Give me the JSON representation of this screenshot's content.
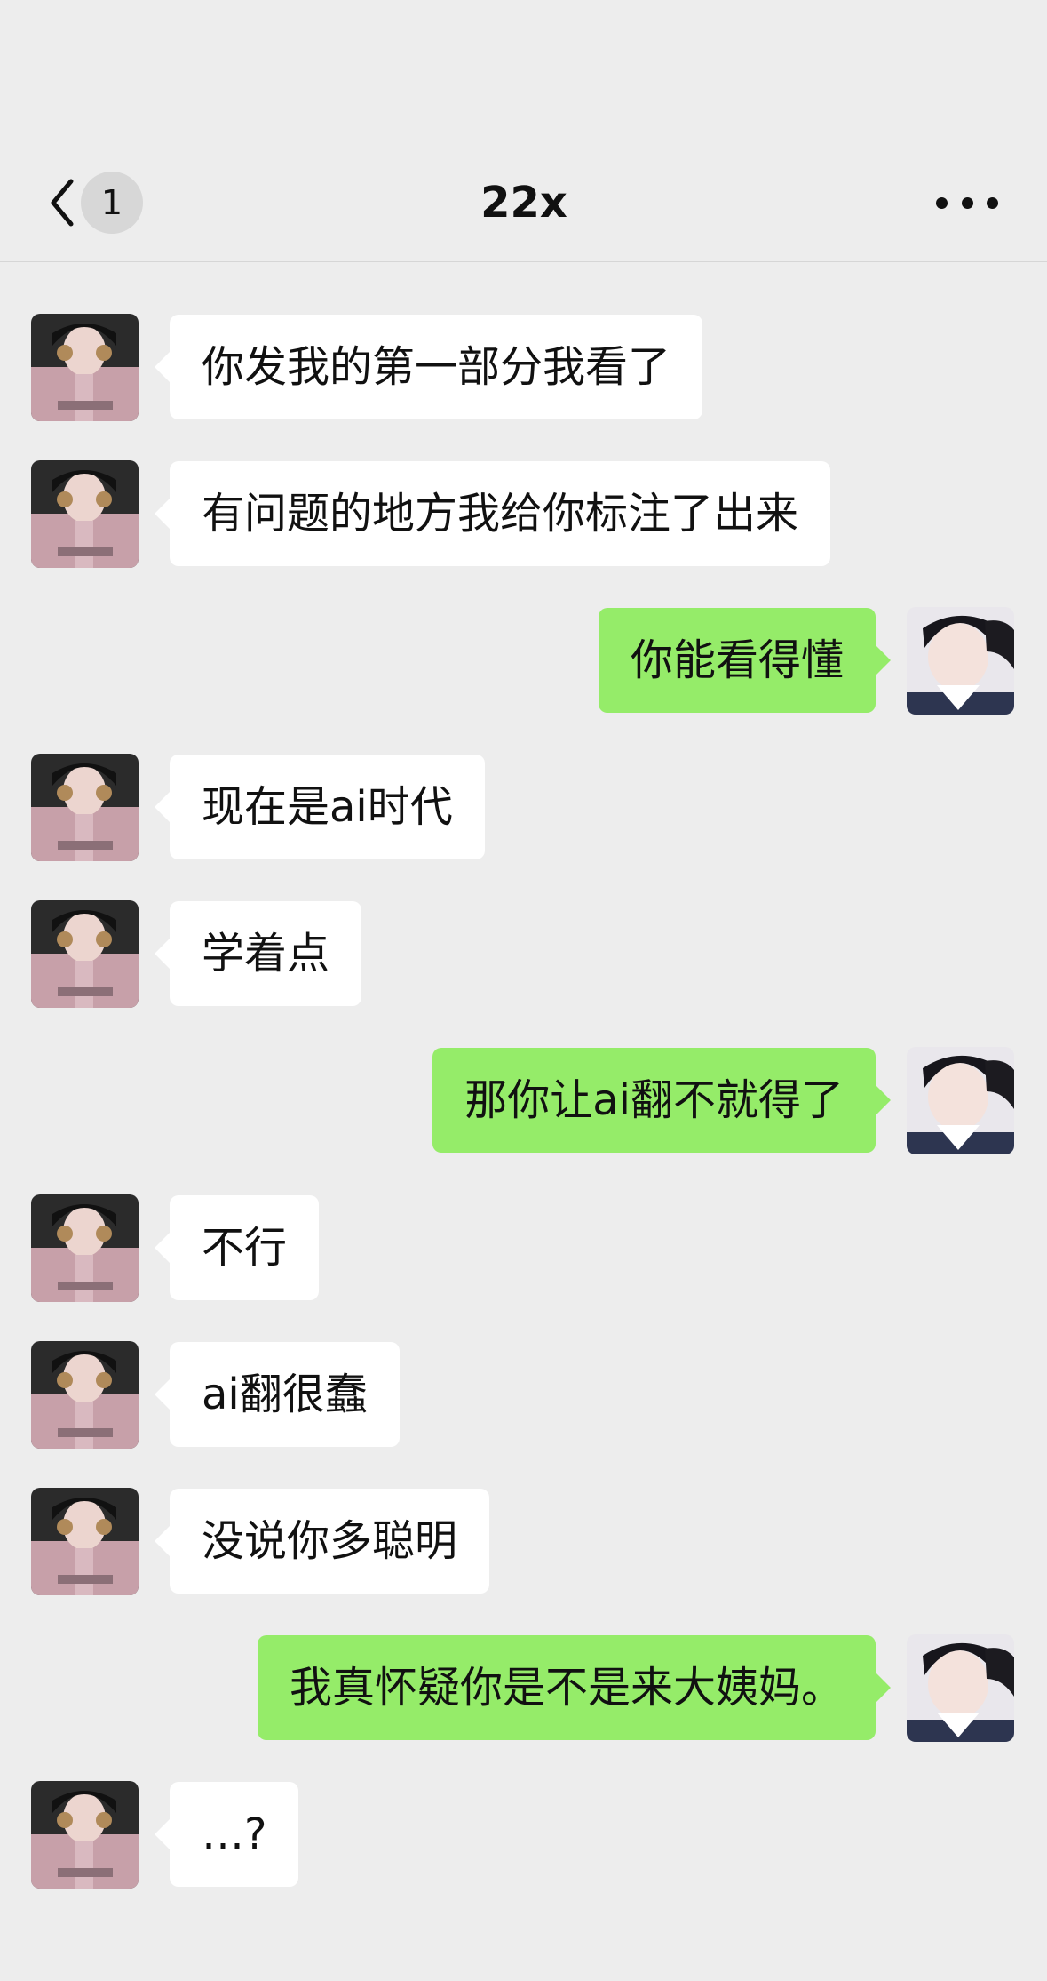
{
  "header": {
    "unread_count": "1",
    "title": "22x"
  },
  "messages": [
    {
      "side": "left",
      "text": "你发我的第一部分我看了"
    },
    {
      "side": "left",
      "text": "有问题的地方我给你标注了出来"
    },
    {
      "side": "right",
      "text": "你能看得懂"
    },
    {
      "side": "left",
      "text": "现在是ai时代"
    },
    {
      "side": "left",
      "text": "学着点"
    },
    {
      "side": "right",
      "text": "那你让ai翻不就得了"
    },
    {
      "side": "left",
      "text": "不行"
    },
    {
      "side": "left",
      "text": "ai翻很蠢"
    },
    {
      "side": "left",
      "text": "没说你多聪明"
    },
    {
      "side": "right",
      "text": "我真怀疑你是不是来大姨妈。"
    },
    {
      "side": "left",
      "text": "…?"
    }
  ],
  "colors": {
    "background": "#ededed",
    "incoming_bubble": "#ffffff",
    "outgoing_bubble": "#95ec69"
  }
}
